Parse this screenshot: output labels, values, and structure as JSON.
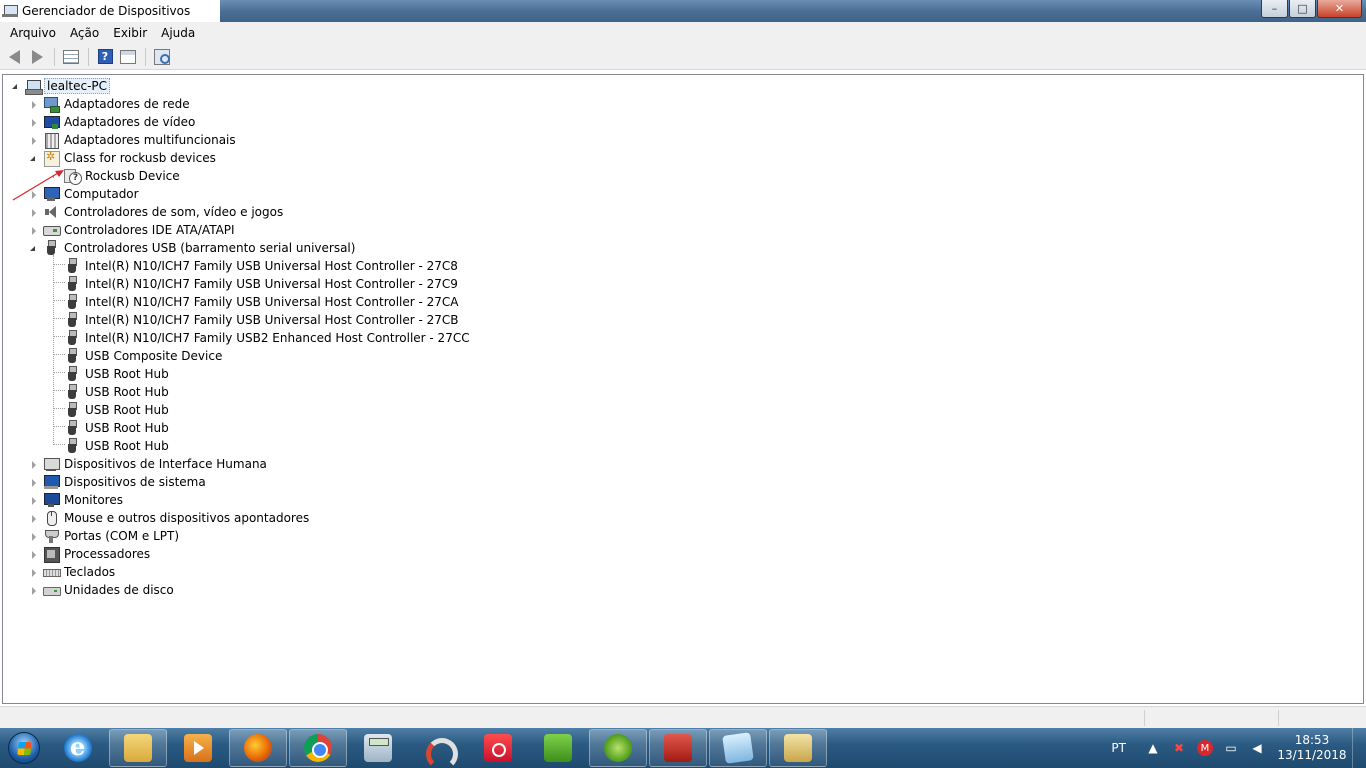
{
  "window": {
    "title": "Gerenciador de Dispositivos",
    "controls": {
      "minimize": "–",
      "maximize": "□",
      "close": "✕"
    }
  },
  "menu": [
    "Arquivo",
    "Ação",
    "Exibir",
    "Ajuda"
  ],
  "toolbar": {
    "buttons": [
      "back-icon",
      "forward-icon",
      "grid-icon",
      "help-icon",
      "properties-icon",
      "scan-hardware-icon"
    ]
  },
  "tree": {
    "root": "lealtec-PC",
    "categories": [
      {
        "label": "Adaptadores de rede",
        "icon": "network-adapter-icon",
        "expanded": false
      },
      {
        "label": "Adaptadores de vídeo",
        "icon": "display-adapter-icon",
        "expanded": false
      },
      {
        "label": "Adaptadores multifuncionais",
        "icon": "multifunction-adapter-icon",
        "expanded": false
      },
      {
        "label": "Class for rockusb devices",
        "icon": "device-class-icon",
        "expanded": true,
        "children": [
          "Rockusb Device"
        ]
      },
      {
        "label": "Computador",
        "icon": "computer-icon",
        "expanded": false
      },
      {
        "label": "Controladores de som, vídeo e jogos",
        "icon": "sound-icon",
        "expanded": false
      },
      {
        "label": "Controladores IDE ATA/ATAPI",
        "icon": "ide-controller-icon",
        "expanded": false
      },
      {
        "label": "Controladores USB (barramento serial universal)",
        "icon": "usb-icon",
        "expanded": true,
        "children": [
          "Intel(R) N10/ICH7 Family USB Universal Host Controller - 27C8",
          "Intel(R) N10/ICH7 Family USB Universal Host Controller - 27C9",
          "Intel(R) N10/ICH7 Family USB Universal Host Controller - 27CA",
          "Intel(R) N10/ICH7 Family USB Universal Host Controller - 27CB",
          "Intel(R) N10/ICH7 Family USB2 Enhanced Host Controller - 27CC",
          "USB Composite Device",
          "USB Root Hub",
          "USB Root Hub",
          "USB Root Hub",
          "USB Root Hub",
          "USB Root Hub"
        ]
      },
      {
        "label": "Dispositivos de Interface Humana",
        "icon": "hid-icon",
        "expanded": false
      },
      {
        "label": "Dispositivos de sistema",
        "icon": "system-device-icon",
        "expanded": false
      },
      {
        "label": "Monitores",
        "icon": "monitor-icon",
        "expanded": false
      },
      {
        "label": "Mouse e outros dispositivos apontadores",
        "icon": "mouse-icon",
        "expanded": false
      },
      {
        "label": "Portas (COM e LPT)",
        "icon": "port-icon",
        "expanded": false
      },
      {
        "label": "Processadores",
        "icon": "processor-icon",
        "expanded": false
      },
      {
        "label": "Teclados",
        "icon": "keyboard-icon",
        "expanded": false
      },
      {
        "label": "Unidades de disco",
        "icon": "disk-drive-icon",
        "expanded": false
      }
    ]
  },
  "colors": {
    "annotation_arrow": "#d9272e",
    "selection": "#e5f0fb"
  },
  "taskbar": {
    "apps": [
      "internet-explorer-icon",
      "file-explorer-icon",
      "media-player-icon",
      "firefox-icon",
      "chrome-icon",
      "calculator-icon",
      "arc-app-icon",
      "camera-app-icon",
      "green-app-icon",
      "download-manager-icon",
      "toolbox-icon",
      "notepad-icon",
      "tools-icon"
    ],
    "language": "PT",
    "time": "18:53",
    "date": "13/11/2018"
  }
}
